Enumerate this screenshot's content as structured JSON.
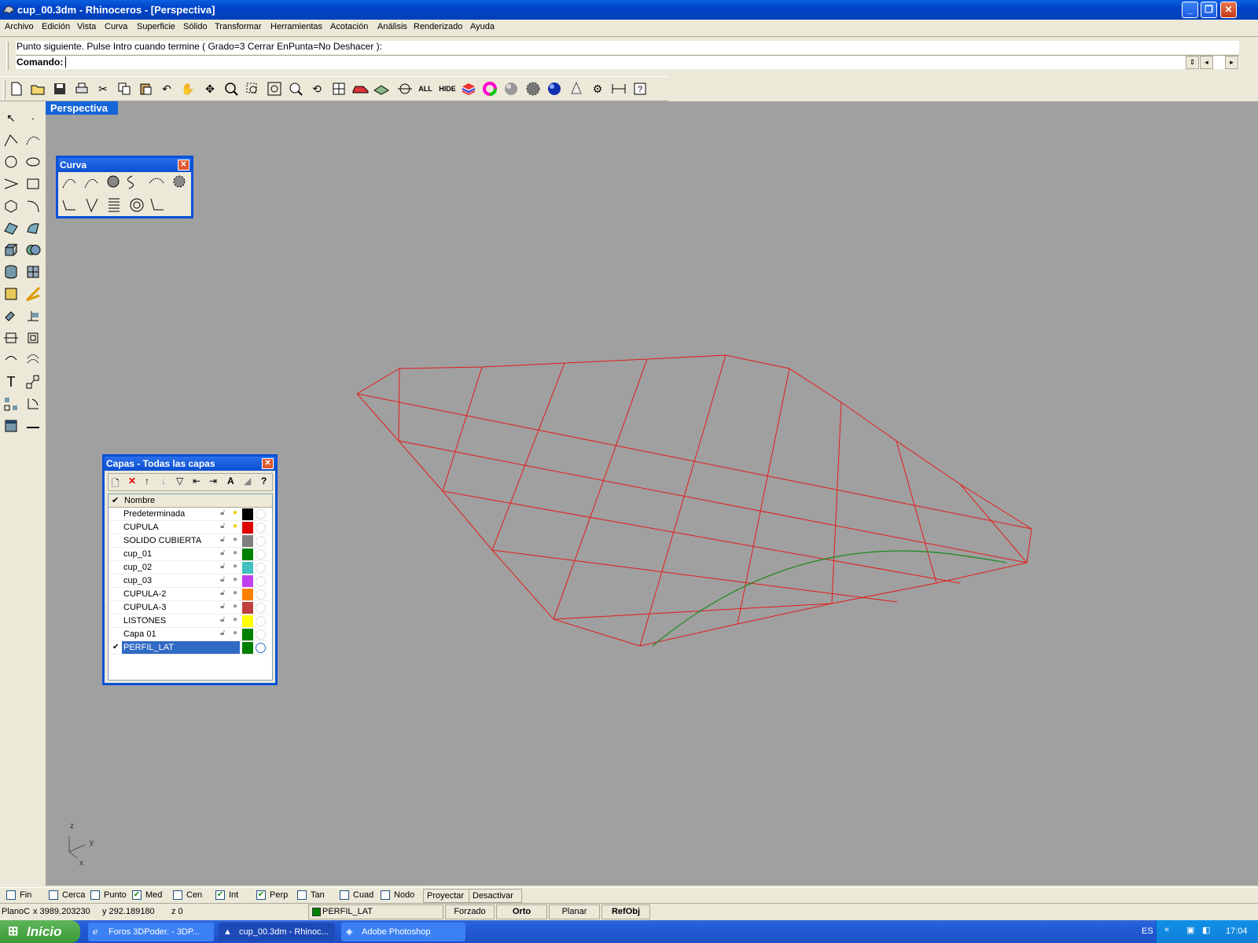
{
  "window": {
    "title": "cup_00.3dm - Rhinoceros - [Perspectiva]",
    "buttons": [
      "minimize",
      "restore",
      "close"
    ]
  },
  "menu": {
    "items": [
      "Archivo",
      "Edición",
      "Vista",
      "Curva",
      "Superficie",
      "Sólido",
      "Transformar",
      "Herramientas",
      "Acotación",
      "Análisis",
      "Renderizado",
      "Ayuda"
    ]
  },
  "command": {
    "prompt": "Punto siguiente. Pulse Intro cuando termine ( Grado=3  Cerrar  EnPunta=No  Deshacer ):",
    "label": "Comando:",
    "value": ""
  },
  "toolbar": {
    "all_label": "ALL",
    "hide_label": "HIDE"
  },
  "viewport": {
    "tab": "Perspectiva",
    "axis_labels": {
      "z": "z",
      "y": "y",
      "x": "x"
    },
    "surface_color": "#e31b1b",
    "curve_color": "#1a8a1a"
  },
  "curve_panel": {
    "title": "Curva"
  },
  "layers_panel": {
    "title": "Capas - Todas las capas",
    "header": "Nombre",
    "layers": [
      {
        "name": "Predeterminada",
        "color": "#000000",
        "bulb": "on",
        "current": false
      },
      {
        "name": "CUPULA",
        "color": "#e00000",
        "bulb": "on",
        "current": false
      },
      {
        "name": "SOLIDO CUBIERTA",
        "color": "#808080",
        "bulb": "off",
        "current": false
      },
      {
        "name": "cup_01",
        "color": "#008000",
        "bulb": "off",
        "current": false
      },
      {
        "name": "cup_02",
        "color": "#40c0c0",
        "bulb": "off",
        "current": false
      },
      {
        "name": "cup_03",
        "color": "#c040f0",
        "bulb": "off",
        "current": false
      },
      {
        "name": "CUPULA-2",
        "color": "#ff8000",
        "bulb": "off",
        "current": false
      },
      {
        "name": "CUPULA-3",
        "color": "#c04040",
        "bulb": "off",
        "current": false
      },
      {
        "name": "LISTONES",
        "color": "#ffff00",
        "bulb": "off",
        "current": false
      },
      {
        "name": "Capa 01",
        "color": "#008000",
        "bulb": "off",
        "current": false
      },
      {
        "name": "PERFIL_LAT",
        "color": "#008000",
        "bulb": "on",
        "current": true
      }
    ]
  },
  "osnaps": [
    {
      "label": "Fin",
      "checked": false
    },
    {
      "label": "Cerca",
      "checked": false
    },
    {
      "label": "Punto",
      "checked": false
    },
    {
      "label": "Med",
      "checked": true
    },
    {
      "label": "Cen",
      "checked": false
    },
    {
      "label": "Int",
      "checked": true
    },
    {
      "label": "Perp",
      "checked": true
    },
    {
      "label": "Tan",
      "checked": false
    },
    {
      "label": "Cuad",
      "checked": false
    },
    {
      "label": "Nodo",
      "checked": false
    }
  ],
  "osnap_buttons": [
    "Proyectar",
    "Desactivar"
  ],
  "status": {
    "plane": "PlanoC",
    "x": "x 3989.203230",
    "y": "y 292.189180",
    "z": "z 0",
    "layer": "PERFIL_LAT",
    "layer_color": "#008000",
    "modes": [
      "Forzado",
      "Orto",
      "Planar",
      "RefObj"
    ]
  },
  "taskbar": {
    "start": "Inicio",
    "tasks": [
      "Foros 3DPoder. - 3DP...",
      "cup_00.3dm - Rhinoc...",
      "Adobe Photoshop"
    ],
    "lang": "ES",
    "clock": "17:04"
  }
}
